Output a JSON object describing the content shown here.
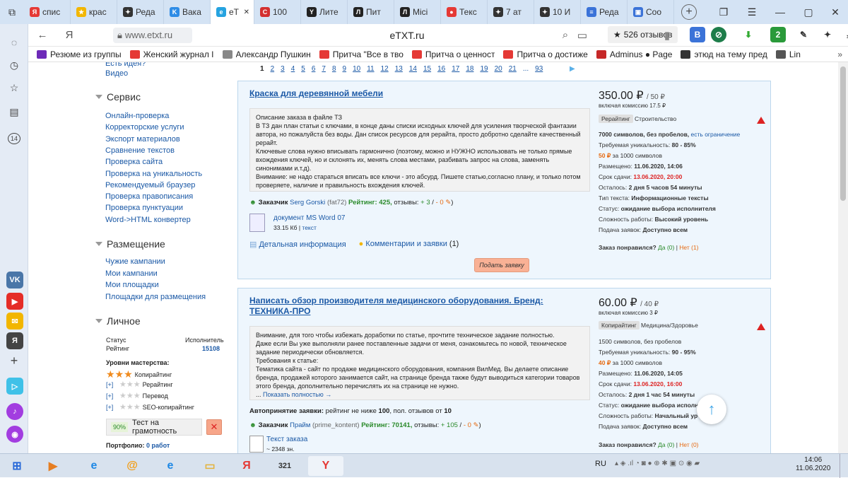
{
  "tabs": [
    {
      "label": "спис",
      "icon": "Я",
      "color": "#e53935"
    },
    {
      "label": "крас",
      "icon": "★",
      "color": "#f2b600"
    },
    {
      "label": "Реда",
      "icon": "✦",
      "color": "#333"
    },
    {
      "label": "Вака",
      "icon": "K",
      "color": "#2e8ce6"
    },
    {
      "label": "eT",
      "icon": "e",
      "color": "#26a3e0"
    },
    {
      "label": "100",
      "icon": "C",
      "color": "#d32f2f"
    },
    {
      "label": "Лите",
      "icon": "Y",
      "color": "#222"
    },
    {
      "label": "Пит",
      "icon": "Л",
      "color": "#222"
    },
    {
      "label": "Місі",
      "icon": "Л",
      "color": "#222"
    },
    {
      "label": "Текс",
      "icon": "●",
      "color": "#e53935"
    },
    {
      "label": "7 ат",
      "icon": "✦",
      "color": "#333"
    },
    {
      "label": "10 И",
      "icon": "✦",
      "color": "#333"
    },
    {
      "label": "Реда",
      "icon": "≡",
      "color": "#3b73d8"
    },
    {
      "label": "Coo",
      "icon": "▣",
      "color": "#3b73d8"
    }
  ],
  "browser": {
    "url": "www.etxt.ru",
    "page_title": "eTXT.ru",
    "reviews": "526 отзывов",
    "ya": "Я"
  },
  "bookmarks": [
    "Резюме из группы",
    "Женский журнал I",
    "Александр Пушкин",
    "Притча \"Все в тво",
    "Притча о ценност",
    "Притча о достиже",
    "Adminus ● Page",
    "этюд на тему пред",
    "Lin"
  ],
  "left_nav": {
    "top_links": [
      "Есть идея?",
      "Видео"
    ],
    "service": {
      "title": "Сервис",
      "links": [
        "Онлайн-проверка",
        "Корректорские услуги",
        "Экспорт материалов",
        "Сравнение текстов",
        "Проверка сайта",
        "Проверка на уникальность",
        "Рекомендуемый браузер",
        "Проверка правописания",
        "Проверка пунктуации",
        "Word->HTML конвертер"
      ]
    },
    "placement": {
      "title": "Размещение",
      "links": [
        "Чужие кампании",
        "Мои кампании",
        "Мои площадки",
        "Площадки для размещения"
      ]
    },
    "personal": {
      "title": "Личное",
      "status_label": "Статус",
      "status_value": "Исполнитель",
      "rating_label": "Рейтинг",
      "rating_value": "15108",
      "levels_label": "Уровни мастерства:",
      "levels": [
        {
          "prefix": "",
          "name": "Копирайтинг"
        },
        {
          "prefix": "[+]",
          "name": "Рерайтинг"
        },
        {
          "prefix": "[+]",
          "name": "Перевод"
        },
        {
          "prefix": "[+]",
          "name": "SEO-копирайтинг"
        }
      ],
      "test_pct": "90%",
      "test_label": "Тест на грамотность",
      "portfolio_label": "Портфолио:",
      "portfolio_value": "0 работ"
    }
  },
  "pagination": [
    "1",
    "2",
    "3",
    "4",
    "5",
    "6",
    "7",
    "8",
    "9",
    "10",
    "11",
    "12",
    "13",
    "14",
    "15",
    "16",
    "17",
    "18",
    "19",
    "20",
    "21",
    "...",
    "93"
  ],
  "orders": [
    {
      "title": "Краска для деревянной мебели",
      "desc_head": "Описание заказа в файле ТЗ",
      "desc": "В ТЗ дан план статьи с ключами, в конце даны списки исходных ключей для усиления творческой фантазии автора, но пожалуйста без воды. Дан список ресурсов для рерайта, просто добротно сделайте качественный рерайт.",
      "desc2": "Ключевые слова нужно вписывать гармонично (поэтому, можно и НУЖНО использовать не только прямые вхождения ключей, но и склонять их, менять слова местами, разбивать запрос на слова, заменять синонимами и.т.д).",
      "desc3": "Внимание: не надо стараться вписать все ключи - это абсурд. Пишете статью,согласно плану, и только потом проверяете, наличие и правильность вхождения ключей.",
      "customer_label": "Заказчик",
      "customer": "Serg Gorski",
      "customer_nick": "(fat72)",
      "rating": "Рейтинг: 425,",
      "reviews_label": "отзывы:",
      "reviews_pos": "+ 3",
      "reviews_neg": "- 0",
      "file_name": "документ MS Word 07",
      "file_size": "33.15 Кб",
      "file_text": "текст",
      "details": "Детальная информация",
      "comments": "Комментарии и заявки",
      "comments_count": "(1)",
      "apply": "Подать заявку",
      "price": "350.00 ₽",
      "price_sub": "/ 50 ₽",
      "commission": "включая комиссию 17.5 ₽",
      "type": "Рерайтинг",
      "category": "Строительство",
      "chars": "7000 символов, без пробелов,",
      "limit": "есть ограничение",
      "uniq_label": "Требуемая уникальность:",
      "uniq": "80 - 85%",
      "per1000": "50 ₽",
      "per1000_label": "за 1000 символов",
      "posted_label": "Размещено:",
      "posted": "11.06.2020, 14:06",
      "deadline_label": "Срок сдачи:",
      "deadline": "13.06.2020, 20:00",
      "left_label": "Осталось:",
      "left": "2 дня 5 часов 54 минуты",
      "texttype_label": "Тип текста:",
      "texttype": "Информационные тексты",
      "status_label": "Статус:",
      "status": "ожидание выбора исполнителя",
      "difficulty_label": "Сложность работы:",
      "difficulty": "Высокий уровень",
      "submit_label": "Подача заявок:",
      "submit": "Доступно всем",
      "like_label": "Заказ понравился?",
      "yes": "Да (0)",
      "no": "Нет (1)"
    },
    {
      "title": "Написать обзор производителя медицинского оборудования. Бренд: ТЕХНИКА-ПРО",
      "desc_head": "Внимание, для того чтобы избежать доработки по статье, прочтите техническое задание полностью.",
      "desc": "Даже если Вы уже выполняли ранее поставленные задачи от меня, ознакомьтесь по новой, техническое задание периодически обновляется.",
      "desc2": "Требования к статье:",
      "desc3": "Тематика сайта - сайт по продаже медицинского оборудования, компания ВилМед. Вы делаете описание бренда, продажей которого занимается сайт, на странице бренда также будут выводиться категории товаров этого бренда, дополнительно перечислять их на странице не нужно.",
      "show_more": "Показать полностью →",
      "auto": "Автопринятие заявки:",
      "auto_text": "рейтинг не ниже",
      "auto_r": "100",
      "auto_text2": ", пол. отзывов от",
      "auto_n": "10",
      "customer_label": "Заказчик",
      "customer": "Прайм",
      "customer_nick": "(prime_kontent)",
      "rating": "Рейтинг: 70141,",
      "reviews_label": "отзывы:",
      "reviews_pos": "+ 105",
      "reviews_neg": "- 0",
      "file_name": "Текст заказа",
      "file_size": "~ 2348 зн.",
      "price": "60.00 ₽",
      "price_sub": "/ 40 ₽",
      "commission": "включая комиссию 3 ₽",
      "type": "Копирайтинг",
      "category": "Медицина/Здоровье",
      "chars": "1500 символов, без пробелов",
      "uniq_label": "Требуемая уникальность:",
      "uniq": "90 - 95%",
      "per1000": "40 ₽",
      "per1000_label": "за 1000 символов",
      "posted_label": "Размещено:",
      "posted": "11.06.2020, 14:05",
      "deadline_label": "Срок сдачи:",
      "deadline": "13.06.2020, 16:00",
      "left_label": "Осталось:",
      "left": "2 дня 1 час 54 минуты",
      "status_label": "Статус:",
      "status": "ожидание выбора исполн",
      "difficulty_label": "Сложность работы:",
      "difficulty": "Начальный ур",
      "submit_label": "Подача заявок:",
      "submit": "Доступно всем",
      "like_label": "Заказ понравился?",
      "yes": "Да (0)",
      "no": "Нет (0)"
    }
  ],
  "taskbar": {
    "lang": "RU",
    "time": "14:06",
    "date": "11.06.2020"
  }
}
